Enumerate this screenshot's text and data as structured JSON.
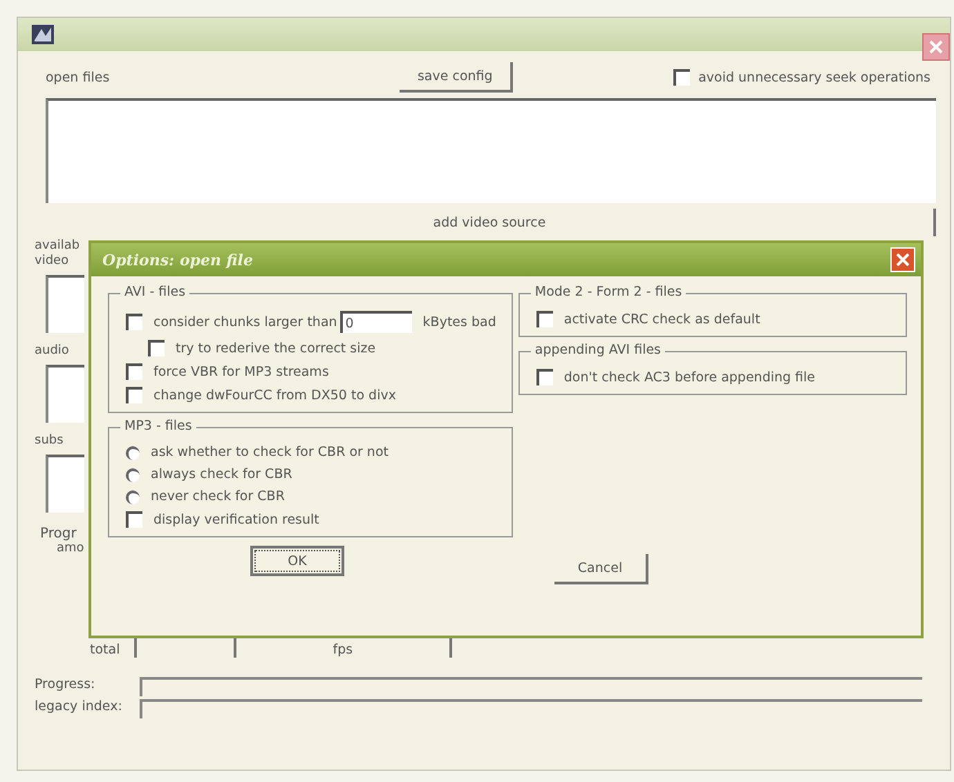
{
  "main": {
    "open_files_label": "open files",
    "save_button": "save config",
    "avoid_seek": {
      "label": "avoid unnecessary seek operations",
      "checked": false
    },
    "add_video_button": "add video source",
    "streams": [
      {
        "lines": [
          "availab",
          "video"
        ]
      },
      {
        "lines": [
          "audio"
        ]
      },
      {
        "lines": [
          "subs"
        ]
      }
    ],
    "progress_group": {
      "title": "Progr",
      "amount_label": "amo",
      "total_label": "total",
      "fps_label": "fps"
    },
    "progress_label": "Progress:",
    "legacy_index_label": "legacy index:"
  },
  "dialog": {
    "title": "Options: open file",
    "left_groups": [
      {
        "title": "AVI - files",
        "items": [
          {
            "kind": "checkbox-field",
            "label": "consider chunks larger than",
            "value": "0",
            "suffix": "kBytes bad",
            "checked": false
          },
          {
            "kind": "sub-checkbox",
            "label": "try to rederive the correct size",
            "checked": false
          },
          {
            "kind": "checkbox",
            "label": "force VBR for MP3 streams",
            "checked": false
          },
          {
            "kind": "checkbox",
            "label": "change dwFourCC from DX50 to divx",
            "checked": false
          }
        ]
      },
      {
        "title": "MP3 - files",
        "items": [
          {
            "kind": "radio",
            "label": "ask whether to check for CBR or not",
            "selected": false
          },
          {
            "kind": "radio",
            "label": "always check for CBR",
            "selected": false
          },
          {
            "kind": "radio",
            "label": "never check for CBR",
            "selected": false
          },
          {
            "kind": "checkbox",
            "label": "display verification result",
            "checked": false
          }
        ]
      }
    ],
    "right_groups": [
      {
        "title": "Mode 2 - Form 2 - files",
        "items": [
          {
            "kind": "checkbox",
            "label": "activate CRC check as default",
            "checked": false
          }
        ]
      },
      {
        "title": "appending AVI files",
        "items": [
          {
            "kind": "checkbox",
            "label": "don't check AC3 before appending file",
            "checked": false
          }
        ]
      }
    ],
    "buttons": [
      {
        "label": "OK",
        "default": true
      },
      {
        "label": "Cancel",
        "default": false
      }
    ]
  }
}
